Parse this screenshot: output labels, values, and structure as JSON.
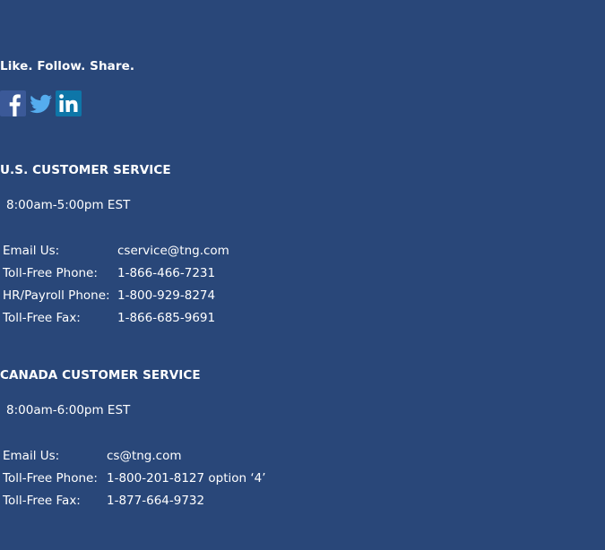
{
  "social": {
    "tagline": "Like. Follow. Share.",
    "icons": [
      "facebook-icon",
      "twitter-icon",
      "linkedin-icon"
    ],
    "colors": {
      "facebook": "#3b5998",
      "twitter": "#55acee",
      "linkedin": "#0e76a8"
    }
  },
  "us": {
    "heading": "U.S. CUSTOMER SERVICE",
    "hours": "8:00am-5:00pm EST",
    "rows": [
      {
        "label": "Email Us:",
        "value": "cservice@tng.com"
      },
      {
        "label": "Toll-Free Phone:",
        "value": "1-866-466-7231"
      },
      {
        "label": "HR/Payroll Phone:",
        "value": "1-800-929-8274"
      },
      {
        "label": "Toll-Free Fax:",
        "value": "1-866-685-9691"
      }
    ]
  },
  "canada": {
    "heading": "CANADA CUSTOMER SERVICE",
    "hours": "8:00am-6:00pm EST",
    "rows": [
      {
        "label": "Email Us:",
        "value": "cs@tng.com"
      },
      {
        "label": "Toll-Free Phone:",
        "value": "1-800-201-8127 option ‘4’"
      },
      {
        "label": "Toll-Free Fax:",
        "value": "1-877-664-9732"
      }
    ]
  },
  "colors": {
    "background": "#294779",
    "text": "#ffffff"
  }
}
